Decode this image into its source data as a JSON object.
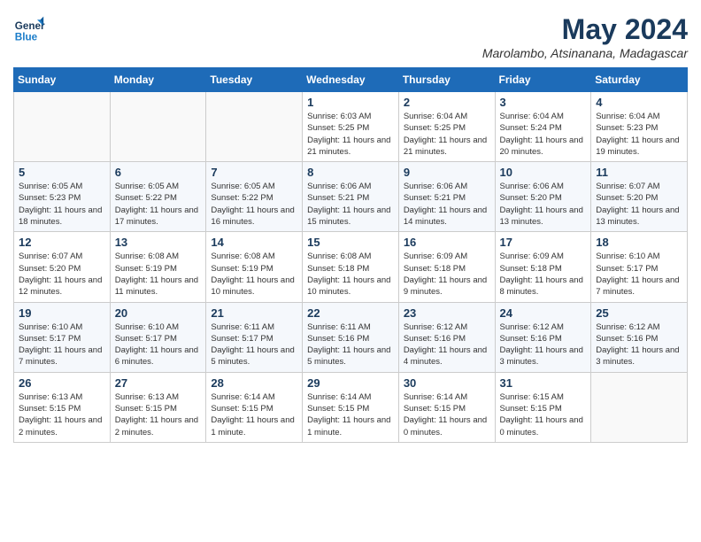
{
  "logo": {
    "line1": "General",
    "line2": "Blue"
  },
  "title": "May 2024",
  "location": "Marolambo, Atsinanana, Madagascar",
  "weekdays": [
    "Sunday",
    "Monday",
    "Tuesday",
    "Wednesday",
    "Thursday",
    "Friday",
    "Saturday"
  ],
  "weeks": [
    [
      {
        "day": "",
        "sunrise": "",
        "sunset": "",
        "daylight": ""
      },
      {
        "day": "",
        "sunrise": "",
        "sunset": "",
        "daylight": ""
      },
      {
        "day": "",
        "sunrise": "",
        "sunset": "",
        "daylight": ""
      },
      {
        "day": "1",
        "sunrise": "Sunrise: 6:03 AM",
        "sunset": "Sunset: 5:25 PM",
        "daylight": "Daylight: 11 hours and 21 minutes."
      },
      {
        "day": "2",
        "sunrise": "Sunrise: 6:04 AM",
        "sunset": "Sunset: 5:25 PM",
        "daylight": "Daylight: 11 hours and 21 minutes."
      },
      {
        "day": "3",
        "sunrise": "Sunrise: 6:04 AM",
        "sunset": "Sunset: 5:24 PM",
        "daylight": "Daylight: 11 hours and 20 minutes."
      },
      {
        "day": "4",
        "sunrise": "Sunrise: 6:04 AM",
        "sunset": "Sunset: 5:23 PM",
        "daylight": "Daylight: 11 hours and 19 minutes."
      }
    ],
    [
      {
        "day": "5",
        "sunrise": "Sunrise: 6:05 AM",
        "sunset": "Sunset: 5:23 PM",
        "daylight": "Daylight: 11 hours and 18 minutes."
      },
      {
        "day": "6",
        "sunrise": "Sunrise: 6:05 AM",
        "sunset": "Sunset: 5:22 PM",
        "daylight": "Daylight: 11 hours and 17 minutes."
      },
      {
        "day": "7",
        "sunrise": "Sunrise: 6:05 AM",
        "sunset": "Sunset: 5:22 PM",
        "daylight": "Daylight: 11 hours and 16 minutes."
      },
      {
        "day": "8",
        "sunrise": "Sunrise: 6:06 AM",
        "sunset": "Sunset: 5:21 PM",
        "daylight": "Daylight: 11 hours and 15 minutes."
      },
      {
        "day": "9",
        "sunrise": "Sunrise: 6:06 AM",
        "sunset": "Sunset: 5:21 PM",
        "daylight": "Daylight: 11 hours and 14 minutes."
      },
      {
        "day": "10",
        "sunrise": "Sunrise: 6:06 AM",
        "sunset": "Sunset: 5:20 PM",
        "daylight": "Daylight: 11 hours and 13 minutes."
      },
      {
        "day": "11",
        "sunrise": "Sunrise: 6:07 AM",
        "sunset": "Sunset: 5:20 PM",
        "daylight": "Daylight: 11 hours and 13 minutes."
      }
    ],
    [
      {
        "day": "12",
        "sunrise": "Sunrise: 6:07 AM",
        "sunset": "Sunset: 5:20 PM",
        "daylight": "Daylight: 11 hours and 12 minutes."
      },
      {
        "day": "13",
        "sunrise": "Sunrise: 6:08 AM",
        "sunset": "Sunset: 5:19 PM",
        "daylight": "Daylight: 11 hours and 11 minutes."
      },
      {
        "day": "14",
        "sunrise": "Sunrise: 6:08 AM",
        "sunset": "Sunset: 5:19 PM",
        "daylight": "Daylight: 11 hours and 10 minutes."
      },
      {
        "day": "15",
        "sunrise": "Sunrise: 6:08 AM",
        "sunset": "Sunset: 5:18 PM",
        "daylight": "Daylight: 11 hours and 10 minutes."
      },
      {
        "day": "16",
        "sunrise": "Sunrise: 6:09 AM",
        "sunset": "Sunset: 5:18 PM",
        "daylight": "Daylight: 11 hours and 9 minutes."
      },
      {
        "day": "17",
        "sunrise": "Sunrise: 6:09 AM",
        "sunset": "Sunset: 5:18 PM",
        "daylight": "Daylight: 11 hours and 8 minutes."
      },
      {
        "day": "18",
        "sunrise": "Sunrise: 6:10 AM",
        "sunset": "Sunset: 5:17 PM",
        "daylight": "Daylight: 11 hours and 7 minutes."
      }
    ],
    [
      {
        "day": "19",
        "sunrise": "Sunrise: 6:10 AM",
        "sunset": "Sunset: 5:17 PM",
        "daylight": "Daylight: 11 hours and 7 minutes."
      },
      {
        "day": "20",
        "sunrise": "Sunrise: 6:10 AM",
        "sunset": "Sunset: 5:17 PM",
        "daylight": "Daylight: 11 hours and 6 minutes."
      },
      {
        "day": "21",
        "sunrise": "Sunrise: 6:11 AM",
        "sunset": "Sunset: 5:17 PM",
        "daylight": "Daylight: 11 hours and 5 minutes."
      },
      {
        "day": "22",
        "sunrise": "Sunrise: 6:11 AM",
        "sunset": "Sunset: 5:16 PM",
        "daylight": "Daylight: 11 hours and 5 minutes."
      },
      {
        "day": "23",
        "sunrise": "Sunrise: 6:12 AM",
        "sunset": "Sunset: 5:16 PM",
        "daylight": "Daylight: 11 hours and 4 minutes."
      },
      {
        "day": "24",
        "sunrise": "Sunrise: 6:12 AM",
        "sunset": "Sunset: 5:16 PM",
        "daylight": "Daylight: 11 hours and 3 minutes."
      },
      {
        "day": "25",
        "sunrise": "Sunrise: 6:12 AM",
        "sunset": "Sunset: 5:16 PM",
        "daylight": "Daylight: 11 hours and 3 minutes."
      }
    ],
    [
      {
        "day": "26",
        "sunrise": "Sunrise: 6:13 AM",
        "sunset": "Sunset: 5:15 PM",
        "daylight": "Daylight: 11 hours and 2 minutes."
      },
      {
        "day": "27",
        "sunrise": "Sunrise: 6:13 AM",
        "sunset": "Sunset: 5:15 PM",
        "daylight": "Daylight: 11 hours and 2 minutes."
      },
      {
        "day": "28",
        "sunrise": "Sunrise: 6:14 AM",
        "sunset": "Sunset: 5:15 PM",
        "daylight": "Daylight: 11 hours and 1 minute."
      },
      {
        "day": "29",
        "sunrise": "Sunrise: 6:14 AM",
        "sunset": "Sunset: 5:15 PM",
        "daylight": "Daylight: 11 hours and 1 minute."
      },
      {
        "day": "30",
        "sunrise": "Sunrise: 6:14 AM",
        "sunset": "Sunset: 5:15 PM",
        "daylight": "Daylight: 11 hours and 0 minutes."
      },
      {
        "day": "31",
        "sunrise": "Sunrise: 6:15 AM",
        "sunset": "Sunset: 5:15 PM",
        "daylight": "Daylight: 11 hours and 0 minutes."
      },
      {
        "day": "",
        "sunrise": "",
        "sunset": "",
        "daylight": ""
      }
    ]
  ]
}
